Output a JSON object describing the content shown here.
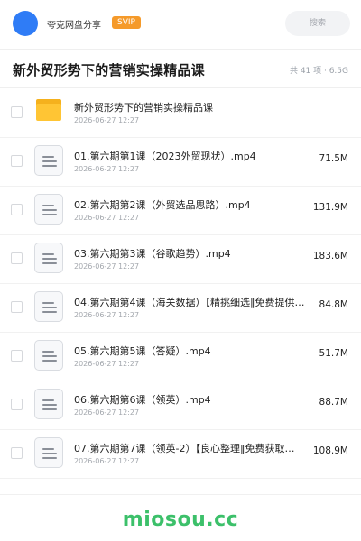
{
  "header": {
    "owner": "夸克网盘分享",
    "badge": "SVIP",
    "search_label": "搜索"
  },
  "titlebar": {
    "title": "新外贸形势下的营销实操精品课",
    "count": "共 41 项 · 6.5G"
  },
  "items": [
    {
      "type": "folder",
      "icon": "folder-icon",
      "name": "新外贸形势下的营销实操精品课",
      "date": "2026-06-27 12:27",
      "size": ""
    },
    {
      "type": "file",
      "icon": "video-file-icon",
      "name": "01.第六期第1课（2023外贸现状）.mp4",
      "date": "2026-06-27 12:27",
      "size": "71.5M"
    },
    {
      "type": "file",
      "icon": "video-file-icon",
      "name": "02.第六期第2课（外贸选品思路）.mp4",
      "date": "2026-06-27 12:27",
      "size": "131.9M"
    },
    {
      "type": "file",
      "icon": "video-file-icon",
      "name": "03.第六期第3课（谷歌趋势）.mp4",
      "date": "2026-06-27 12:27",
      "size": "183.6M"
    },
    {
      "type": "file",
      "icon": "video-file-icon",
      "name": "04.第六期第4课（海关数据）【精挑细选‖免费提供…",
      "date": "2026-06-27 12:27",
      "size": "84.8M"
    },
    {
      "type": "file",
      "icon": "video-file-icon",
      "name": "05.第六期第5课（答疑）.mp4",
      "date": "2026-06-27 12:27",
      "size": "51.7M"
    },
    {
      "type": "file",
      "icon": "video-file-icon",
      "name": "06.第六期第6课（领英）.mp4",
      "date": "2026-06-27 12:27",
      "size": "88.7M"
    },
    {
      "type": "file",
      "icon": "video-file-icon",
      "name": "07.第六期第7课（领英-2）【良心整理‖免费获取…",
      "date": "2026-06-27 12:27",
      "size": "108.9M"
    }
  ],
  "footer": {
    "watermark": "miosou.cc"
  },
  "colors": {
    "accent_blue": "#2f7cf6",
    "svip_orange": "#f59a2a",
    "folder_yellow": "#ffc534",
    "watermark_green": "#3cc06a"
  }
}
